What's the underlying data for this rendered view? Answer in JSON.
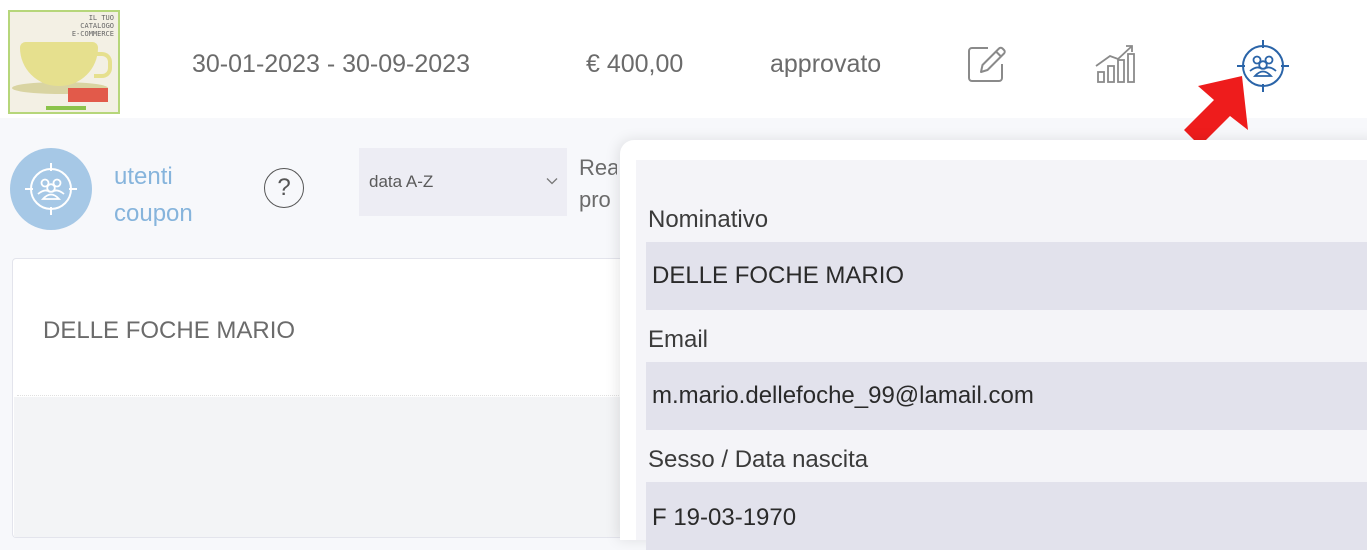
{
  "header": {
    "thumbnail": {
      "title_line1": "IL TUO",
      "title_line2": "CATALOGO",
      "title_line3": "E-COMMERCE"
    },
    "dates": "30-01-2023 - 30-09-2023",
    "amount": "€ 400,00",
    "status": "approvato",
    "icons": [
      "edit-icon",
      "stats-icon",
      "users-target-icon"
    ],
    "arrow_color": "#ee1c1c"
  },
  "toolbar": {
    "section_line1": "utenti",
    "section_line2": "coupon",
    "help": "?",
    "sort_value": "data A-Z",
    "cut_line1": "Rea",
    "cut_line2": "pro",
    "accent_color": "#86b4dc"
  },
  "list": {
    "items": [
      "DELLE FOCHE MARIO"
    ]
  },
  "detail": {
    "fields": [
      {
        "label": "Nominativo",
        "value": "DELLE FOCHE MARIO"
      },
      {
        "label": "Email",
        "value": "m.mario.dellefoche_99@lamail.com"
      },
      {
        "label": "Sesso / Data nascita",
        "value": "F 19-03-1970"
      }
    ]
  }
}
